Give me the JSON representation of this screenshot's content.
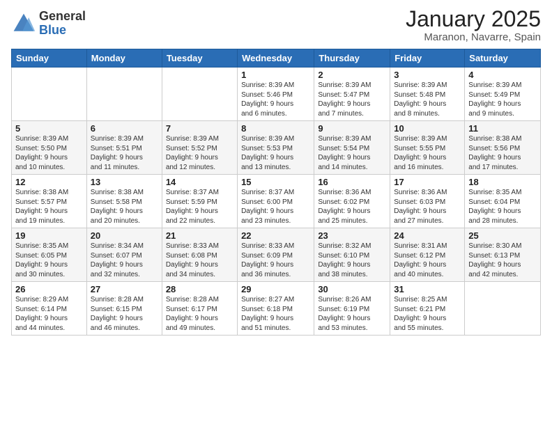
{
  "logo": {
    "general": "General",
    "blue": "Blue"
  },
  "header": {
    "month": "January 2025",
    "location": "Maranon, Navarre, Spain"
  },
  "weekdays": [
    "Sunday",
    "Monday",
    "Tuesday",
    "Wednesday",
    "Thursday",
    "Friday",
    "Saturday"
  ],
  "weeks": [
    [
      {
        "day": "",
        "info": ""
      },
      {
        "day": "",
        "info": ""
      },
      {
        "day": "",
        "info": ""
      },
      {
        "day": "1",
        "info": "Sunrise: 8:39 AM\nSunset: 5:46 PM\nDaylight: 9 hours\nand 6 minutes."
      },
      {
        "day": "2",
        "info": "Sunrise: 8:39 AM\nSunset: 5:47 PM\nDaylight: 9 hours\nand 7 minutes."
      },
      {
        "day": "3",
        "info": "Sunrise: 8:39 AM\nSunset: 5:48 PM\nDaylight: 9 hours\nand 8 minutes."
      },
      {
        "day": "4",
        "info": "Sunrise: 8:39 AM\nSunset: 5:49 PM\nDaylight: 9 hours\nand 9 minutes."
      }
    ],
    [
      {
        "day": "5",
        "info": "Sunrise: 8:39 AM\nSunset: 5:50 PM\nDaylight: 9 hours\nand 10 minutes."
      },
      {
        "day": "6",
        "info": "Sunrise: 8:39 AM\nSunset: 5:51 PM\nDaylight: 9 hours\nand 11 minutes."
      },
      {
        "day": "7",
        "info": "Sunrise: 8:39 AM\nSunset: 5:52 PM\nDaylight: 9 hours\nand 12 minutes."
      },
      {
        "day": "8",
        "info": "Sunrise: 8:39 AM\nSunset: 5:53 PM\nDaylight: 9 hours\nand 13 minutes."
      },
      {
        "day": "9",
        "info": "Sunrise: 8:39 AM\nSunset: 5:54 PM\nDaylight: 9 hours\nand 14 minutes."
      },
      {
        "day": "10",
        "info": "Sunrise: 8:39 AM\nSunset: 5:55 PM\nDaylight: 9 hours\nand 16 minutes."
      },
      {
        "day": "11",
        "info": "Sunrise: 8:38 AM\nSunset: 5:56 PM\nDaylight: 9 hours\nand 17 minutes."
      }
    ],
    [
      {
        "day": "12",
        "info": "Sunrise: 8:38 AM\nSunset: 5:57 PM\nDaylight: 9 hours\nand 19 minutes."
      },
      {
        "day": "13",
        "info": "Sunrise: 8:38 AM\nSunset: 5:58 PM\nDaylight: 9 hours\nand 20 minutes."
      },
      {
        "day": "14",
        "info": "Sunrise: 8:37 AM\nSunset: 5:59 PM\nDaylight: 9 hours\nand 22 minutes."
      },
      {
        "day": "15",
        "info": "Sunrise: 8:37 AM\nSunset: 6:00 PM\nDaylight: 9 hours\nand 23 minutes."
      },
      {
        "day": "16",
        "info": "Sunrise: 8:36 AM\nSunset: 6:02 PM\nDaylight: 9 hours\nand 25 minutes."
      },
      {
        "day": "17",
        "info": "Sunrise: 8:36 AM\nSunset: 6:03 PM\nDaylight: 9 hours\nand 27 minutes."
      },
      {
        "day": "18",
        "info": "Sunrise: 8:35 AM\nSunset: 6:04 PM\nDaylight: 9 hours\nand 28 minutes."
      }
    ],
    [
      {
        "day": "19",
        "info": "Sunrise: 8:35 AM\nSunset: 6:05 PM\nDaylight: 9 hours\nand 30 minutes."
      },
      {
        "day": "20",
        "info": "Sunrise: 8:34 AM\nSunset: 6:07 PM\nDaylight: 9 hours\nand 32 minutes."
      },
      {
        "day": "21",
        "info": "Sunrise: 8:33 AM\nSunset: 6:08 PM\nDaylight: 9 hours\nand 34 minutes."
      },
      {
        "day": "22",
        "info": "Sunrise: 8:33 AM\nSunset: 6:09 PM\nDaylight: 9 hours\nand 36 minutes."
      },
      {
        "day": "23",
        "info": "Sunrise: 8:32 AM\nSunset: 6:10 PM\nDaylight: 9 hours\nand 38 minutes."
      },
      {
        "day": "24",
        "info": "Sunrise: 8:31 AM\nSunset: 6:12 PM\nDaylight: 9 hours\nand 40 minutes."
      },
      {
        "day": "25",
        "info": "Sunrise: 8:30 AM\nSunset: 6:13 PM\nDaylight: 9 hours\nand 42 minutes."
      }
    ],
    [
      {
        "day": "26",
        "info": "Sunrise: 8:29 AM\nSunset: 6:14 PM\nDaylight: 9 hours\nand 44 minutes."
      },
      {
        "day": "27",
        "info": "Sunrise: 8:28 AM\nSunset: 6:15 PM\nDaylight: 9 hours\nand 46 minutes."
      },
      {
        "day": "28",
        "info": "Sunrise: 8:28 AM\nSunset: 6:17 PM\nDaylight: 9 hours\nand 49 minutes."
      },
      {
        "day": "29",
        "info": "Sunrise: 8:27 AM\nSunset: 6:18 PM\nDaylight: 9 hours\nand 51 minutes."
      },
      {
        "day": "30",
        "info": "Sunrise: 8:26 AM\nSunset: 6:19 PM\nDaylight: 9 hours\nand 53 minutes."
      },
      {
        "day": "31",
        "info": "Sunrise: 8:25 AM\nSunset: 6:21 PM\nDaylight: 9 hours\nand 55 minutes."
      },
      {
        "day": "",
        "info": ""
      }
    ]
  ]
}
